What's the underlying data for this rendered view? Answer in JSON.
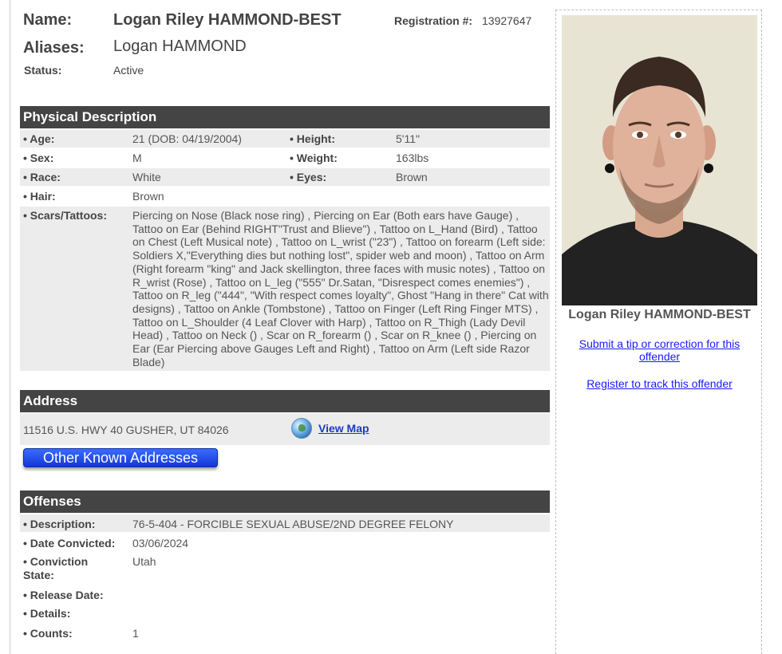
{
  "header": {
    "name_label": "Name:",
    "name_value": "Logan Riley HAMMOND-BEST",
    "registration_label": "Registration #:",
    "registration_value": "13927647",
    "aliases_label": "Aliases:",
    "aliases_value": "Logan HAMMOND",
    "status_label": "Status:",
    "status_value": "Active"
  },
  "physical": {
    "title": "Physical Description",
    "age_label": "• Age:",
    "age_value": "21  (DOB: 04/19/2004)",
    "height_label": "• Height:",
    "height_value": "5'11\"",
    "sex_label": "• Sex:",
    "sex_value": "M",
    "weight_label": "• Weight:",
    "weight_value": "163lbs",
    "race_label": "• Race:",
    "race_value": "White",
    "eyes_label": "• Eyes:",
    "eyes_value": "Brown",
    "hair_label": "• Hair:",
    "hair_value": "Brown",
    "scars_label": "• Scars/Tattoos:",
    "scars_value": "Piercing on Nose (Black nose ring) , Piercing on Ear (Both ears have Gauge) , Tattoo on Ear (Behind RIGHT\"Trust and Blieve\") , Tattoo on L_Hand (Bird) , Tattoo on Chest (Left Musical note) , Tattoo on L_wrist (\"23\") , Tattoo on forearm (Left side: Soldiers X,\"Everything dies but nothing lost\", spider web and moon) , Tattoo on Arm (Right forearm \"king\" and Jack skellington, three faces with music notes) , Tattoo on R_wrist (Rose) , Tattoo on L_leg (\"555\" Dr.Satan, \"Disrespect comes enemies\") , Tattoo on R_leg (\"444\", \"With respect comes loyalty\", Ghost \"Hang in there\" Cat with designs) , Tattoo on Ankle (Tombstone) , Tattoo on Finger (Left Ring Finger MTS) , Tattoo on L_Shoulder (4 Leaf Clover with Harp) , Tattoo on R_Thigh (Lady Devil Head) , Tattoo on Neck () , Scar on R_forearm () , Scar on R_knee () , Piercing on Ear (Ear Piercing above Gauges Left and Right) , Tattoo on Arm (Left side Razor Blade)"
  },
  "address": {
    "title": "Address",
    "value": "11516 U.S. HWY 40 GUSHER, UT 84026",
    "view_map_label": "View Map",
    "other_addresses_label": "Other Known Addresses"
  },
  "offenses": {
    "title": "Offenses",
    "description_label": "• Description:",
    "description_value": "76-5-404 - FORCIBLE SEXUAL ABUSE/2ND DEGREE FELONY",
    "date_label": "• Date Convicted:",
    "date_value": "03/06/2024",
    "state_label_1": "• Conviction",
    "state_label_2": "State:",
    "state_value": "Utah",
    "release_label": "• Release Date:",
    "release_value": "",
    "details_label": "• Details:",
    "details_value": "",
    "counts_label": "• Counts:",
    "counts_value": "1"
  },
  "sidebar": {
    "photo_caption": "Logan Riley HAMMOND-BEST",
    "tip_link": "Submit a tip or correction for this offender",
    "track_link": "Register to track this offender"
  }
}
